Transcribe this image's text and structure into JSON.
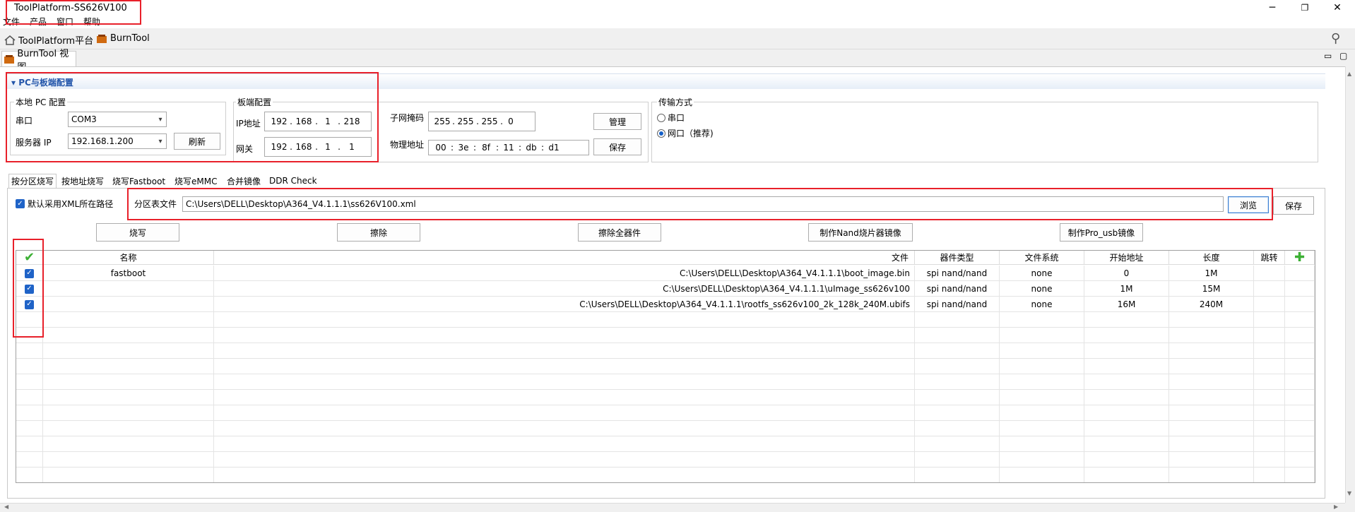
{
  "window": {
    "title": "ToolPlatform-SS626V100",
    "minimize": "─",
    "restore": "❐",
    "close": "✕"
  },
  "menu": [
    "文件",
    "产品",
    "窗口",
    "帮助"
  ],
  "toolbar": {
    "items": [
      "ToolPlatform平台",
      "BurnTool"
    ],
    "search_glyph": "⚲"
  },
  "view_tab": {
    "label": "BurnTool 视图"
  },
  "view_controls": {
    "minimize": "▭",
    "maximize": "▢"
  },
  "section": {
    "title": "PC与板端配置",
    "arrow": "▾"
  },
  "local_pc": {
    "group_title": "本地 PC 配置",
    "serial_label": "串口",
    "serial_value": "COM3",
    "server_ip_label": "服务器 IP",
    "server_ip_value": "192.168.1.200",
    "refresh_button": "刷新"
  },
  "board": {
    "group_title": "板端配置",
    "ip_label": "IP地址",
    "ip": [
      "192",
      "168",
      "1",
      "218"
    ],
    "gateway_label": "网关",
    "gateway": [
      "192",
      "168",
      "1",
      "1"
    ],
    "subnet_label": "子网掩码",
    "subnet": [
      "255",
      "255",
      "255",
      "0"
    ],
    "mac_label": "物理地址",
    "mac": [
      "00",
      "3e",
      "8f",
      "11",
      "db",
      "d1"
    ],
    "manage_button": "管理",
    "save_button": "保存"
  },
  "transfer": {
    "group_title": "传输方式",
    "serial_option": "串口",
    "network_option": "网口（推荐)",
    "selected": "network"
  },
  "tabs": [
    "按分区烧写",
    "按地址烧写",
    "烧写Fastboot",
    "烧写eMMC",
    "合并镜像",
    "DDR Check"
  ],
  "active_tab": 0,
  "partition": {
    "use_xml_path_label": "默认采用XML所在路径",
    "use_xml_path_checked": true,
    "file_label": "分区表文件",
    "file_value": "C:\\Users\\DELL\\Desktop\\A364_V4.1.1.1\\ss626V100.xml",
    "browse_button": "浏览",
    "save_button": "保存"
  },
  "actions": [
    "烧写",
    "擦除",
    "擦除全器件",
    "制作Nand烧片器镜像",
    "制作Pro_usb镜像"
  ],
  "table": {
    "columns": [
      "",
      "名称",
      "文件",
      "器件类型",
      "文件系统",
      "开始地址",
      "长度",
      "跳转",
      ""
    ],
    "header_check_glyph": "✔",
    "add_glyph": "✚",
    "rows": [
      {
        "checked": true,
        "name": "fastboot",
        "file": "C:\\Users\\DELL\\Desktop\\A364_V4.1.1.1\\boot_image.bin",
        "device": "spi nand/nand",
        "fs": "none",
        "start": "0",
        "length": "1M",
        "jump": ""
      },
      {
        "checked": true,
        "name": "",
        "file": "C:\\Users\\DELL\\Desktop\\A364_V4.1.1.1\\uImage_ss626v100",
        "device": "spi nand/nand",
        "fs": "none",
        "start": "1M",
        "length": "15M",
        "jump": ""
      },
      {
        "checked": true,
        "name": "",
        "file": "C:\\Users\\DELL\\Desktop\\A364_V4.1.1.1\\rootfs_ss626v100_2k_128k_240M.ubifs",
        "device": "spi nand/nand",
        "fs": "none",
        "start": "16M",
        "length": "240M",
        "jump": ""
      }
    ],
    "empty_rows": 11,
    "check_glyph": "✓"
  },
  "colors": {
    "highlight": "#e8202a",
    "accent": "#1f63c7",
    "add": "#3cb034"
  }
}
